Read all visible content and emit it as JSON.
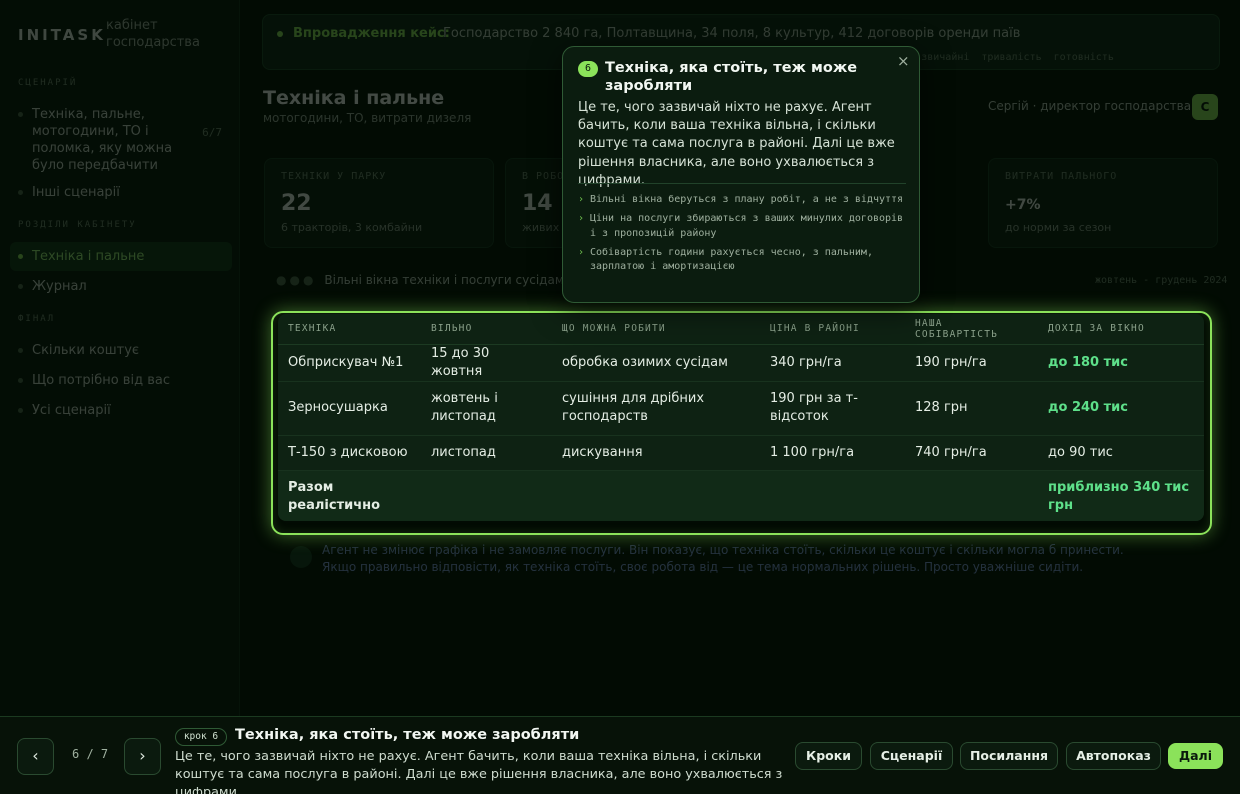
{
  "app": {
    "brand": "INITASK",
    "brand_sub": "кабінет господарства",
    "sidebar": {
      "section1": "СЦЕНАРІЙ",
      "scenario_item": "Техніка, пальне, мотогодини, ТО і поломка, яку можна було передбачити",
      "scenario_count": "6/7",
      "other_scenarios": "Інші сценарії",
      "section2": "РОЗДІЛИ КАБІНЕТУ",
      "active_item": "Техніка і пальне",
      "journal": "Журнал",
      "section3": "ФІНАЛ",
      "final_items": [
        "Скільки коштує",
        "Що потрібно від вас",
        "Усі сценарії"
      ]
    },
    "scenario_bar": {
      "label": "Впровадження кейс:",
      "text": "Господарство 2 840 га, Полтавщина, 34 поля, 8 культур, 412 договорів оренди паїв",
      "links": "поля  цифри звичайні  тривалість  готовність"
    },
    "page_title": "Техніка і пальне",
    "page_sub": "мотогодини, ТО, витрати дизеля",
    "user_name": "Сергій · директор господарства",
    "avatar": "С",
    "stats": [
      {
        "label": "ТЕХНІКИ У ПАРКУ",
        "value": "22",
        "note": "6 тракторів, 3 комбайни"
      },
      {
        "label": "В РОБОТІ",
        "value": "14",
        "note": "живих"
      },
      {
        "label": "ВИТРАТИ ПАЛЬНОГО",
        "value": "+7%",
        "note": "до норми за сезон"
      }
    ],
    "panel_title": "Вільні вікна техніки і послуги сусідам",
    "panel_date": "жовтень - грудень 2024",
    "note_text": "Агент не змінює графіка і не замовляє послуги. Він показує, що техніка стоїть, скільки це коштує і скільки могла б принести. Якщо правильно відповісти, як техніка стоїть, своє робота від — це тема нормальних рішень. Просто уважніше сидіти."
  },
  "table": {
    "headers": [
      "ТЕХНІКА",
      "ВІЛЬНО",
      "ЩО МОЖНА РОБИТИ",
      "ЦІНА В РАЙОНІ",
      "НАША СОБІВАРТІСТЬ",
      "ДОХІД ЗА ВІКНО"
    ],
    "rows": [
      [
        "Обприскувач №1",
        "15 до 30 жовтня",
        "обробка озимих сусідам",
        "340 грн/га",
        "190 грн/га",
        "до 180 тис"
      ],
      [
        "Зерносушарка",
        "жовтень і листопад",
        "сушіння для дрібних господарств",
        "190 грн за т-відсоток",
        "128 грн",
        "до 240 тис"
      ],
      [
        "Т-150 з дисковою",
        "листопад",
        "дискування",
        "1 100 грн/га",
        "740 грн/га",
        "до 90 тис"
      ]
    ],
    "total_label": "Разом реалістично",
    "total_value": "приблизно 340 тис грн",
    "income_highlight_color": "#5ee08a"
  },
  "popover": {
    "step": "6",
    "title": "Техніка, яка стоїть, теж може заробляти",
    "close_icon": "×",
    "body": "Це те, чого зазвичай ніхто не рахує. Агент бачить, коли ваша техніка вільна, і скільки коштує та сама послуга в районі. Далі це вже рішення власника, але воно ухвалюється з цифрами.",
    "bullets": [
      "Вільні вікна беруться з плану робіт, а не з відчуття",
      "Ціни на послуги збираються з ваших минулих договорів і з пропозицій району",
      "Собівартість години рахується чесно, з пальним, зарплатою і амортизацією"
    ]
  },
  "tour": {
    "prev_icon": "‹",
    "next_icon": "›",
    "counter": "6 / 7",
    "step_badge": "крок 6",
    "title": "Техніка, яка стоїть, теж може заробляти",
    "text": "Це те, чого зазвичай ніхто не рахує. Агент бачить, коли ваша техніка вільна, і скільки коштує та сама послуга в районі. Далі це вже рішення власника, але воно ухвалюється з цифрами.",
    "buttons": [
      "Кроки",
      "Сценарії",
      "Посилання",
      "Автопоказ"
    ],
    "primary": "Далі"
  },
  "colors": {
    "accent": "#8be25a",
    "background": "#061206"
  }
}
